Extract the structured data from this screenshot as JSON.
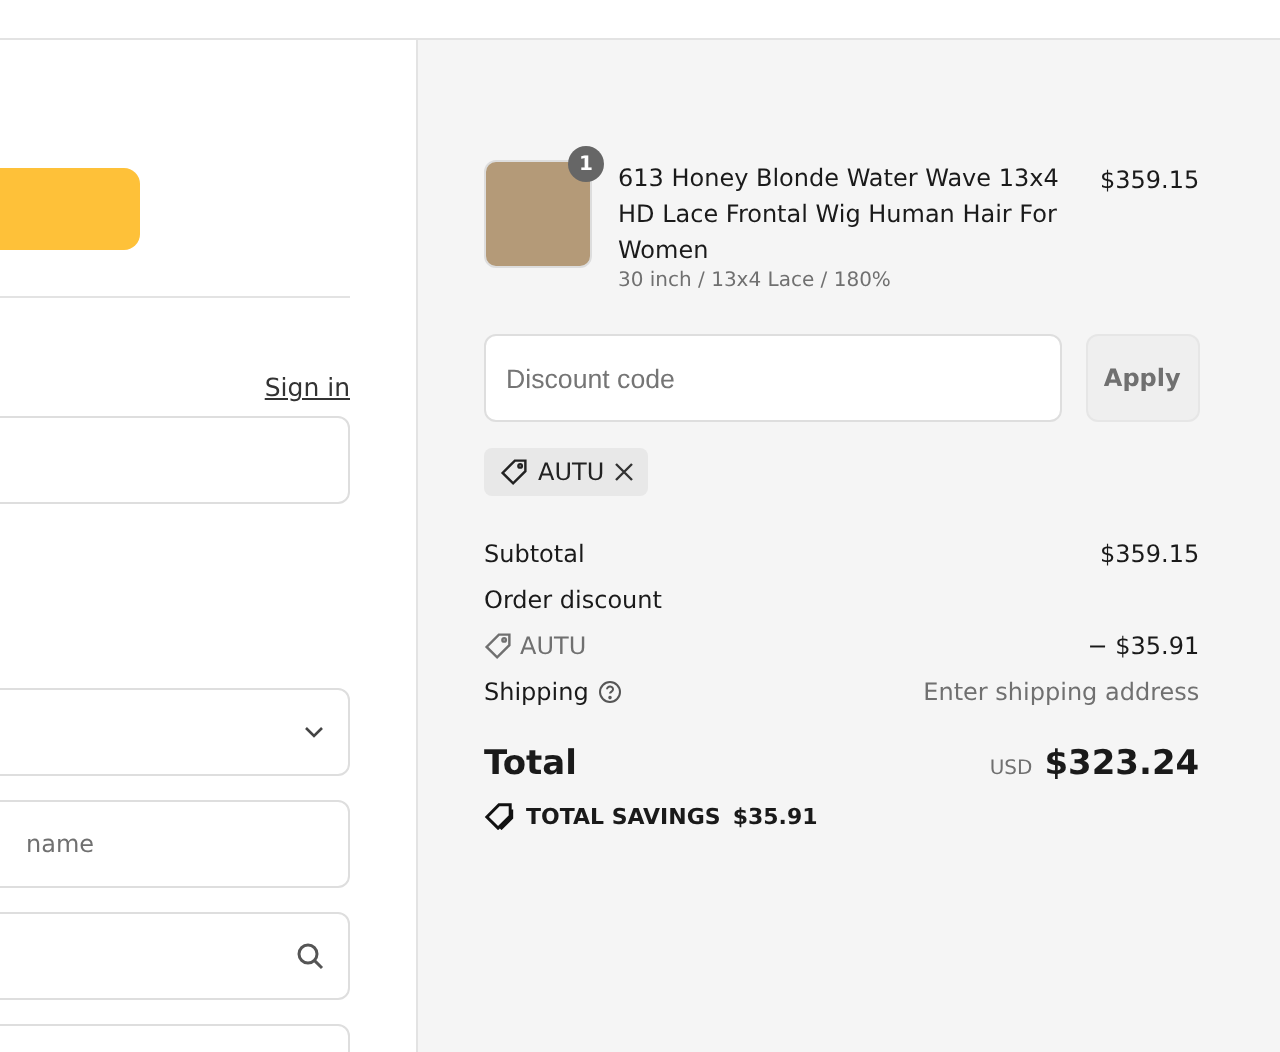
{
  "contact": {
    "sign_in": "Sign in"
  },
  "delivery": {
    "fields": [
      {
        "kind": "select"
      },
      {
        "kind": "text",
        "placeholder": "name"
      },
      {
        "kind": "search"
      },
      {
        "kind": "text"
      }
    ]
  },
  "summary": {
    "item": {
      "quantity": "1",
      "title": "613 Honey Blonde Water Wave 13x4 HD Lace Frontal Wig Human Hair For Women",
      "variant": "30 inch / 13x4 Lace / 180%",
      "price": "$359.15"
    },
    "discount": {
      "placeholder": "Discount code",
      "button": "Apply",
      "applied_code": "AUTU"
    },
    "lines": [
      {
        "kind": "plain",
        "label": "Subtotal",
        "value": "$359.15"
      },
      {
        "kind": "heading",
        "label": "Order discount"
      },
      {
        "kind": "code",
        "label": "AUTU",
        "value": "− $35.91"
      },
      {
        "kind": "help",
        "label": "Shipping",
        "value": "Enter shipping address"
      }
    ],
    "total": {
      "label": "Total",
      "currency": "USD",
      "value": "$323.24"
    },
    "savings": {
      "label": "TOTAL SAVINGS",
      "value": "$35.91"
    }
  }
}
